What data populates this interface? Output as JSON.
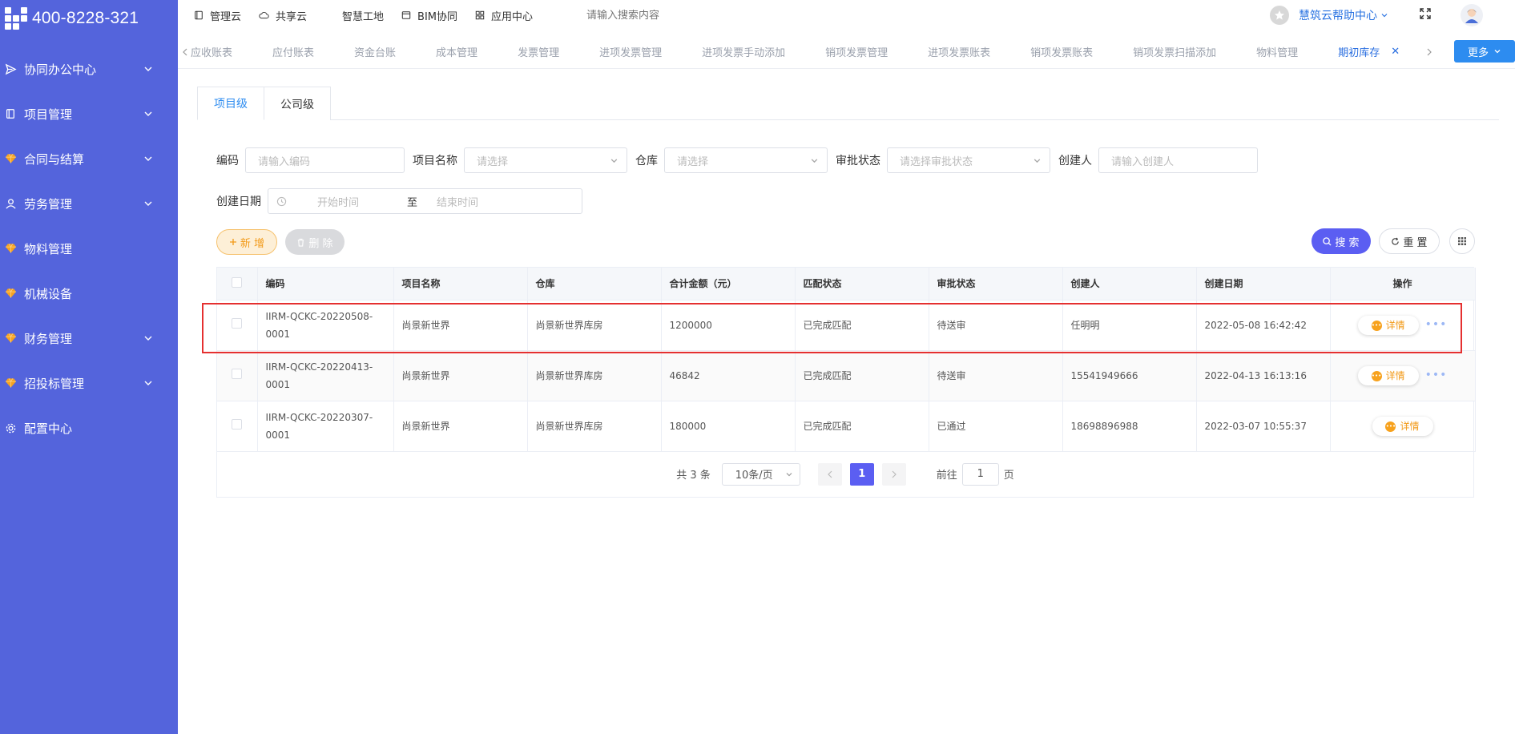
{
  "brand": {
    "phone": "400-8228-321"
  },
  "sidebar": {
    "items": [
      {
        "label": "协同办公中心",
        "icon": "send-icon",
        "has_children": true
      },
      {
        "label": "项目管理",
        "icon": "book-icon",
        "has_children": true
      },
      {
        "label": "合同与结算",
        "icon": "gem-icon",
        "has_children": true
      },
      {
        "label": "劳务管理",
        "icon": "user-icon",
        "has_children": true
      },
      {
        "label": "物料管理",
        "icon": "gem-icon",
        "has_children": false
      },
      {
        "label": "机械设备",
        "icon": "gem-icon",
        "has_children": false
      },
      {
        "label": "财务管理",
        "icon": "gem-icon",
        "has_children": true
      },
      {
        "label": "招投标管理",
        "icon": "gem-icon",
        "has_children": true
      },
      {
        "label": "配置中心",
        "icon": "gear-icon",
        "has_children": false
      }
    ]
  },
  "topnav": {
    "items": [
      {
        "label": "管理云",
        "icon": "doc-icon"
      },
      {
        "label": "共享云",
        "icon": "cloud-icon"
      },
      {
        "label": "智慧工地",
        "icon": "book-icon"
      },
      {
        "label": "BIM协同",
        "icon": "window-icon"
      },
      {
        "label": "应用中心",
        "icon": "apps-icon"
      }
    ],
    "search_placeholder": "请输入搜索内容",
    "help_label": "慧筑云帮助中心"
  },
  "tags": {
    "items": [
      "应收账表",
      "应付账表",
      "资金台账",
      "成本管理",
      "发票管理",
      "进项发票管理",
      "进项发票手动添加",
      "销项发票管理",
      "进项发票账表",
      "销项发票账表",
      "销项发票扫描添加",
      "物料管理"
    ],
    "active": "期初库存",
    "more_label": "更多"
  },
  "tabs": {
    "project": "项目级",
    "company": "公司级"
  },
  "filters": {
    "code_label": "编码",
    "code_placeholder": "请输入编码",
    "project_label": "项目名称",
    "project_placeholder": "请选择",
    "warehouse_label": "仓库",
    "warehouse_placeholder": "请选择",
    "approval_label": "审批状态",
    "approval_placeholder": "请选择审批状态",
    "creator_label": "创建人",
    "creator_placeholder": "请输入创建人",
    "date_label": "创建日期",
    "date_start": "开始时间",
    "date_sep": "至",
    "date_end": "结束时间"
  },
  "actions": {
    "add": "新 增",
    "delete": "删 除",
    "search": "搜 索",
    "reset": "重 置"
  },
  "table": {
    "headers": [
      "编码",
      "项目名称",
      "仓库",
      "合计金额（元）",
      "匹配状态",
      "审批状态",
      "创建人",
      "创建日期",
      "操作"
    ],
    "detail_label": "详情",
    "rows": [
      {
        "code": "IIRM-QCKC-20220508-0001",
        "project": "尚景新世界",
        "warehouse": "尚景新世界库房",
        "amount": "1200000",
        "match": "已完成匹配",
        "approval": "待送审",
        "creator": "任明明",
        "date": "2022-05-08 16:42:42",
        "more": true
      },
      {
        "code": "IIRM-QCKC-20220413-0001",
        "project": "尚景新世界",
        "warehouse": "尚景新世界库房",
        "amount": "46842",
        "match": "已完成匹配",
        "approval": "待送审",
        "creator": "15541949666",
        "date": "2022-04-13 16:13:16",
        "more": true
      },
      {
        "code": "IIRM-QCKC-20220307-0001",
        "project": "尚景新世界",
        "warehouse": "尚景新世界库房",
        "amount": "180000",
        "match": "已完成匹配",
        "approval": "已通过",
        "creator": "18698896988",
        "date": "2022-03-07 10:55:37",
        "more": false
      }
    ]
  },
  "pager": {
    "total": "共 3 条",
    "size": "10条/页",
    "page": "1",
    "goto_prefix": "前往",
    "goto_value": "1",
    "goto_suffix": "页"
  },
  "colors": {
    "sidebar": "#5464dc",
    "primary": "#5b5ef2",
    "accent_orange": "#f29a18",
    "highlight": "#e53030"
  }
}
